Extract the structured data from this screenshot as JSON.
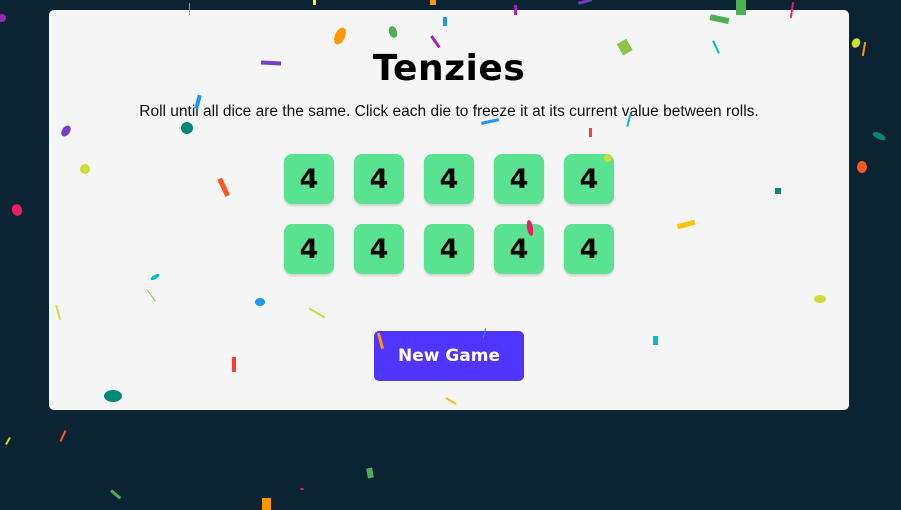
{
  "game": {
    "title": "Tenzies",
    "instructions": "Roll until all dice are the same. Click each die to freeze it at its current value between rolls.",
    "dice": [
      "4",
      "4",
      "4",
      "4",
      "4",
      "4",
      "4",
      "4",
      "4",
      "4"
    ],
    "new_game_label": "New Game"
  },
  "colors": {
    "background": "#0b2434",
    "card": "#f5f5f5",
    "die_held": "#59e391",
    "button": "#5035ff"
  }
}
